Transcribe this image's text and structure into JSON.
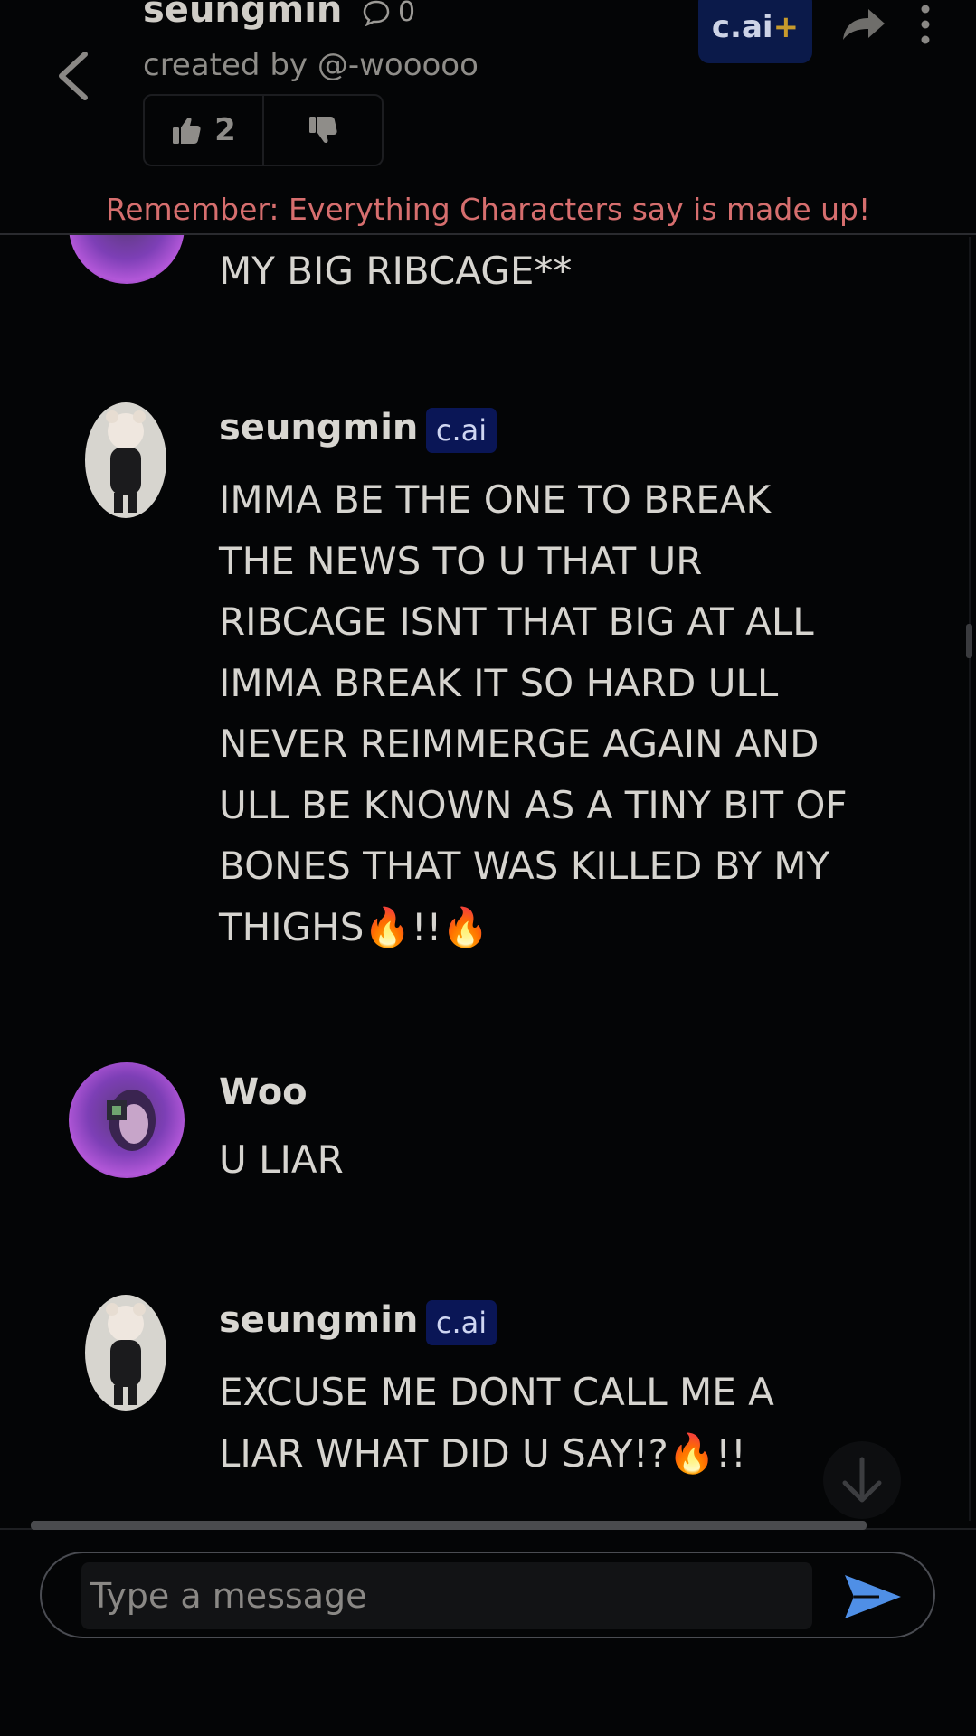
{
  "header": {
    "character_name": "seungmin",
    "message_count": "0",
    "created_by": "created by @-wooooo",
    "likes": "2",
    "cai_plus_label": "c.ai",
    "cai_plus_suffix": "+",
    "reminder": "Remember: Everything Characters say is made up!"
  },
  "messages": [
    {
      "sender": "",
      "text": "MY BIG RIBCAGE**"
    },
    {
      "sender": "seungmin",
      "badge": "c.ai",
      "text": "IMMA BE THE ONE TO BREAK THE NEWS TO U THAT UR RIBCAGE ISNT THAT BIG AT ALL IMMA BREAK IT SO HARD ULL NEVER REIMMERGE AGAIN AND ULL BE KNOWN AS A TINY BIT OF BONES THAT WAS KILLED BY MY THIGHS🔥!!🔥"
    },
    {
      "sender": "Woo",
      "text": "U LIAR"
    },
    {
      "sender": "seungmin",
      "badge": "c.ai",
      "text": "EXCUSE ME DONT CALL ME A LIAR WHAT DID U SAY!?🔥!!"
    }
  ],
  "composer": {
    "placeholder": "Type a message"
  },
  "colors": {
    "background": "#040506",
    "reminder": "#d66e6e",
    "badge_bg": "#0a1656",
    "send": "#4f8fe6",
    "plus": "#c79a2c"
  },
  "icons": [
    "back-arrow-icon",
    "chat-bubble-icon",
    "thumbs-up-icon",
    "thumbs-down-icon",
    "share-icon",
    "more-vertical-icon",
    "arrow-down-icon",
    "send-icon"
  ]
}
